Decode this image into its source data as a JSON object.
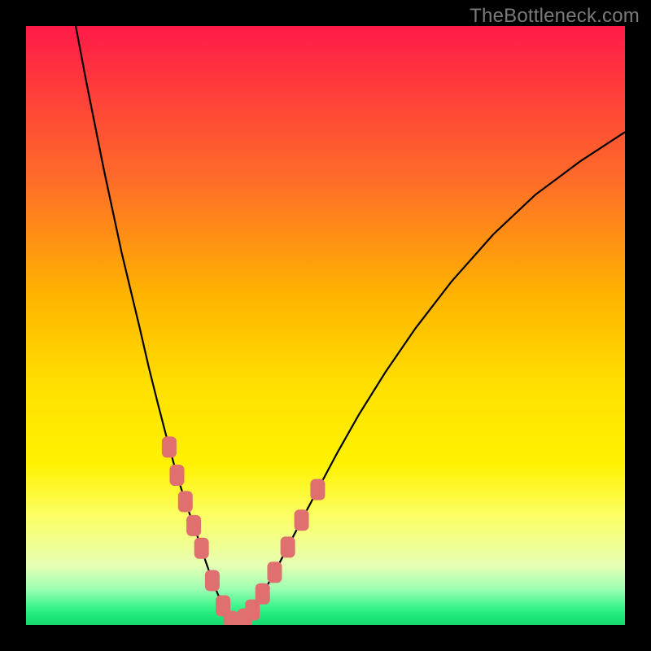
{
  "watermark": "TheBottleneck.com",
  "colors": {
    "background": "#000000",
    "gradient_top": "#ff1a4a",
    "gradient_bottom": "#18d86e",
    "curve": "#000000",
    "marker": "#e07070"
  },
  "chart_data": {
    "type": "line",
    "title": "",
    "xlabel": "",
    "ylabel": "",
    "xlim": [
      0,
      1
    ],
    "ylim": [
      0,
      1
    ],
    "series": [
      {
        "name": "bottleneck-curve",
        "x": [
          0.083,
          0.1,
          0.13,
          0.16,
          0.19,
          0.205,
          0.22,
          0.234,
          0.252,
          0.266,
          0.28,
          0.293,
          0.3,
          0.311,
          0.32,
          0.329,
          0.337,
          0.342,
          0.349,
          0.356,
          0.365,
          0.378,
          0.395,
          0.415,
          0.437,
          0.46,
          0.487,
          0.52,
          0.555,
          0.6,
          0.65,
          0.71,
          0.78,
          0.85,
          0.925,
          1.0
        ],
        "y": [
          1.0,
          0.91,
          0.76,
          0.62,
          0.495,
          0.43,
          0.37,
          0.316,
          0.25,
          0.206,
          0.166,
          0.128,
          0.106,
          0.074,
          0.052,
          0.032,
          0.016,
          0.006,
          0.0,
          0.002,
          0.01,
          0.025,
          0.052,
          0.088,
          0.13,
          0.175,
          0.226,
          0.288,
          0.35,
          0.422,
          0.495,
          0.573,
          0.652,
          0.718,
          0.774,
          0.823
        ]
      }
    ],
    "markers": {
      "name": "highlighted-points",
      "x_positions": [
        0.239,
        0.252,
        0.266,
        0.28,
        0.293,
        0.311,
        0.329,
        0.342,
        0.349,
        0.356,
        0.365,
        0.378,
        0.395,
        0.415,
        0.437,
        0.46,
        0.487
      ],
      "y_positions": [
        0.297,
        0.25,
        0.206,
        0.166,
        0.128,
        0.074,
        0.032,
        0.006,
        0.0,
        0.002,
        0.01,
        0.025,
        0.052,
        0.088,
        0.13,
        0.175,
        0.226
      ]
    }
  }
}
